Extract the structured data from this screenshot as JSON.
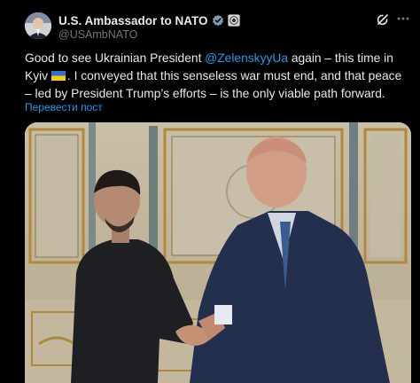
{
  "account": {
    "display_name": "U.S. Ambassador to NATO",
    "handle": "@USAmbNATO",
    "avatar_icon": "avatar-portrait",
    "verified_icon": "verified-badge-icon",
    "affiliate_icon": "government-affiliate-icon"
  },
  "toolbar": {
    "grok_icon": "grok-icon",
    "more_icon": "more-options-icon"
  },
  "post": {
    "text_1": "Good to see Ukrainian President ",
    "mention": "@ZelenskyyUa",
    "text_2": " again – this time in Kyiv ",
    "text_3": ". I conveyed that this senseless war must end, and that peace – led by President Trump’s efforts – is the only viable path forward.",
    "flag_icon": "ukraine-flag-icon",
    "translate_label": "Перевести пост"
  },
  "colors": {
    "background": "#000000",
    "text": "#e7e9ea",
    "secondary": "#71767b",
    "link": "#1d9bf0"
  }
}
